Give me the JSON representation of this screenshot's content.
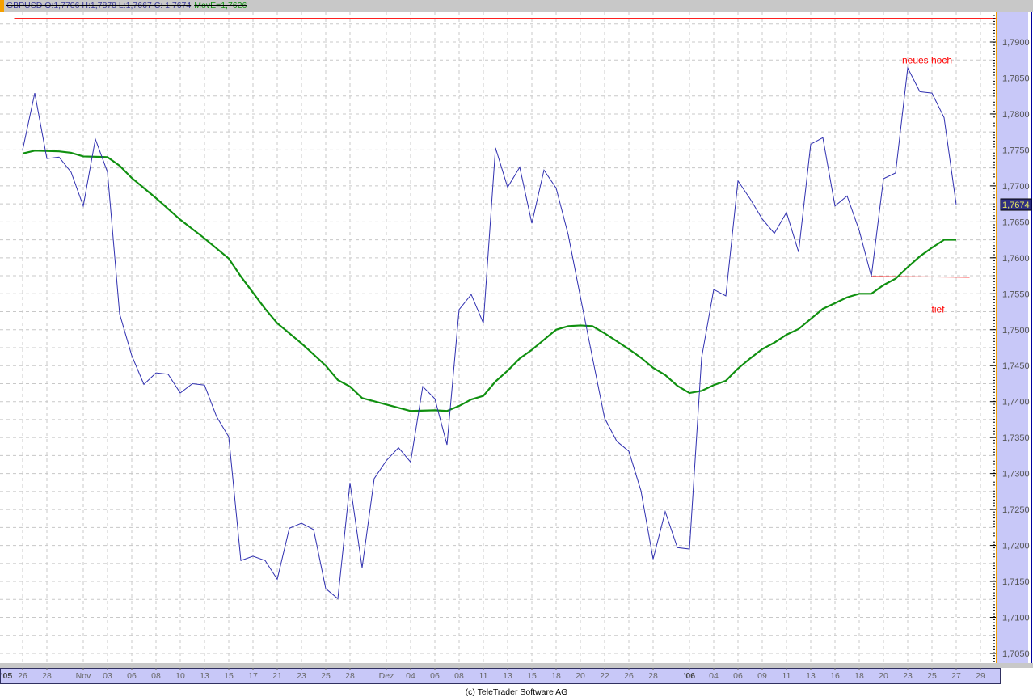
{
  "header": {
    "symbol_quote": "GBPUSD O:1,7706 H:1,7878 L:1,7667 C: 1,7674",
    "ma_label": "MovE=1,7626"
  },
  "copyright": "(c) TeleTrader Software AG",
  "colors": {
    "price": "#3030b0",
    "ma": "#109010",
    "lines": "#ff0000",
    "axis_bg": "#c8c8f8",
    "accent": "#f5a000"
  },
  "chart_data": {
    "type": "line",
    "title": "GBPUSD",
    "ylim": [
      1.7025,
      1.7945
    ],
    "yticks": [
      "1,7050",
      "1,7100",
      "1,7150",
      "1,7200",
      "1,7250",
      "1,7300",
      "1,7350",
      "1,7400",
      "1,7450",
      "1,7500",
      "1,7550",
      "1,7600",
      "1,7650",
      "1,7700",
      "1,7750",
      "1,7800",
      "1,7850",
      "1,7900"
    ],
    "ytick_values": [
      1.705,
      1.71,
      1.715,
      1.72,
      1.725,
      1.73,
      1.735,
      1.74,
      1.745,
      1.75,
      1.755,
      1.76,
      1.765,
      1.77,
      1.775,
      1.78,
      1.785,
      1.79
    ],
    "last_price_label": "1,7674",
    "last_price": 1.7674,
    "xticks": [
      {
        "label": "'05",
        "at": -1.4,
        "bold": true
      },
      {
        "label": "26",
        "at": 0
      },
      {
        "label": "28",
        "at": 2
      },
      {
        "label": "Nov",
        "at": 5
      },
      {
        "label": "03",
        "at": 7
      },
      {
        "label": "06",
        "at": 9
      },
      {
        "label": "08",
        "at": 11
      },
      {
        "label": "10",
        "at": 13
      },
      {
        "label": "13",
        "at": 15
      },
      {
        "label": "15",
        "at": 17
      },
      {
        "label": "17",
        "at": 19
      },
      {
        "label": "21",
        "at": 21
      },
      {
        "label": "23",
        "at": 23
      },
      {
        "label": "25",
        "at": 25
      },
      {
        "label": "28",
        "at": 27
      },
      {
        "label": "Dez",
        "at": 30
      },
      {
        "label": "04",
        "at": 32
      },
      {
        "label": "06",
        "at": 34
      },
      {
        "label": "08",
        "at": 36
      },
      {
        "label": "11",
        "at": 38
      },
      {
        "label": "13",
        "at": 40
      },
      {
        "label": "15",
        "at": 42
      },
      {
        "label": "18",
        "at": 44
      },
      {
        "label": "20",
        "at": 46
      },
      {
        "label": "22",
        "at": 48
      },
      {
        "label": "26",
        "at": 50
      },
      {
        "label": "28",
        "at": 52
      },
      {
        "label": "'06",
        "at": 55,
        "bold": true
      },
      {
        "label": "04",
        "at": 57
      },
      {
        "label": "06",
        "at": 59
      },
      {
        "label": "09",
        "at": 61
      },
      {
        "label": "11",
        "at": 63
      },
      {
        "label": "13",
        "at": 65
      },
      {
        "label": "16",
        "at": 67
      },
      {
        "label": "18",
        "at": 69
      },
      {
        "label": "20",
        "at": 71
      },
      {
        "label": "23",
        "at": 73
      },
      {
        "label": "25",
        "at": 75
      },
      {
        "label": "27",
        "at": 77
      },
      {
        "label": "29",
        "at": 79
      }
    ],
    "series": [
      {
        "name": "GBPUSD",
        "values": [
          1.775,
          1.7829,
          1.7738,
          1.774,
          1.7719,
          1.7672,
          1.7765,
          1.7719,
          1.7522,
          1.7464,
          1.7424,
          1.744,
          1.7438,
          1.7412,
          1.7425,
          1.7423,
          1.7379,
          1.7351,
          1.7179,
          1.7185,
          1.7179,
          1.7153,
          1.7224,
          1.7231,
          1.7222,
          1.714,
          1.7126,
          1.7287,
          1.7169,
          1.7293,
          1.7318,
          1.7336,
          1.7316,
          1.7421,
          1.7404,
          1.734,
          1.7528,
          1.7549,
          1.7509,
          1.7753,
          1.7698,
          1.7726,
          1.7648,
          1.7722,
          1.7697,
          1.7632,
          1.7546,
          1.7461,
          1.7377,
          1.7345,
          1.7331,
          1.7276,
          1.7181,
          1.7247,
          1.7197,
          1.7195,
          1.7461,
          1.7556,
          1.7547,
          1.7707,
          1.7682,
          1.7654,
          1.7634,
          1.7663,
          1.7608,
          1.7758,
          1.7767,
          1.7672,
          1.7686,
          1.7638,
          1.7574,
          1.771,
          1.7718,
          1.7864,
          1.7831,
          1.7829,
          1.7795,
          1.7674
        ]
      },
      {
        "name": "MovE",
        "index": [
          0,
          1,
          3,
          4,
          5,
          7,
          8,
          9,
          11,
          13,
          15,
          17,
          18,
          20,
          21,
          23,
          25,
          26,
          27,
          28,
          30,
          32,
          34,
          35,
          36,
          37,
          38,
          39,
          40,
          41,
          42,
          43,
          44,
          45,
          46,
          47,
          48,
          49,
          50,
          51,
          52,
          53,
          54,
          55,
          56,
          57,
          58,
          59,
          60,
          61,
          62,
          63,
          64,
          65,
          66,
          67,
          68,
          69,
          70,
          71,
          72,
          73,
          74,
          75,
          76,
          77
        ],
        "values": [
          1.7745,
          1.7749,
          1.7748,
          1.7746,
          1.7741,
          1.774,
          1.7728,
          1.7711,
          1.7683,
          1.7653,
          1.7627,
          1.7599,
          1.7574,
          1.7529,
          1.7509,
          1.7481,
          1.745,
          1.743,
          1.7421,
          1.7405,
          1.7396,
          1.7387,
          1.7388,
          1.7387,
          1.7394,
          1.7403,
          1.7408,
          1.7428,
          1.7443,
          1.746,
          1.7472,
          1.7486,
          1.75,
          1.7505,
          1.7506,
          1.7505,
          1.7495,
          1.7484,
          1.7473,
          1.7461,
          1.7447,
          1.7437,
          1.7422,
          1.7412,
          1.7415,
          1.7423,
          1.7429,
          1.7446,
          1.746,
          1.7473,
          1.7482,
          1.7493,
          1.7501,
          1.7515,
          1.7529,
          1.7537,
          1.7545,
          1.755,
          1.755,
          1.7562,
          1.7571,
          1.7587,
          1.7602,
          1.7614,
          1.7625,
          1.7625
        ]
      }
    ],
    "lines": [
      {
        "name": "resistance",
        "from": [
          -0.7,
          1.7933
        ],
        "to": [
          80.3,
          1.7933
        ]
      },
      {
        "name": "support",
        "from": [
          70,
          1.7574
        ],
        "to": [
          78.1,
          1.7573
        ]
      }
    ],
    "annotations": [
      {
        "text": "neues hoch",
        "at": [
          74.6,
          1.787
        ]
      },
      {
        "text": "tief",
        "at": [
          75.5,
          1.7524
        ]
      }
    ]
  }
}
